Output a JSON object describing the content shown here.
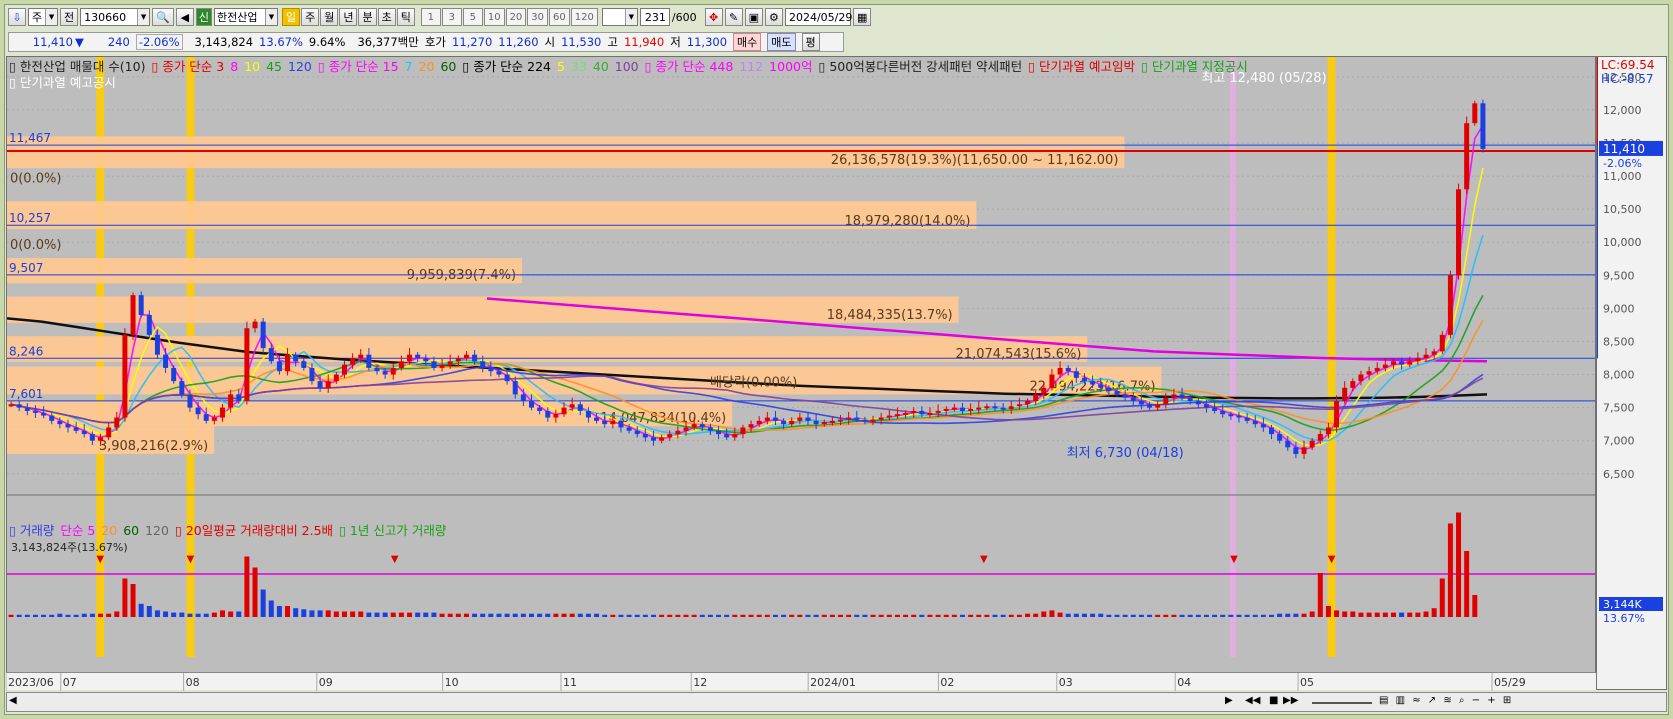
{
  "toolbar": {
    "market": "주",
    "mode": "전",
    "code": "130660",
    "name": "한전산업",
    "periods": [
      "일",
      "주",
      "월",
      "년",
      "분",
      "초",
      "틱"
    ],
    "active_period": "일",
    "minutes": [
      "1",
      "3",
      "5",
      "10",
      "20",
      "30",
      "60",
      "120"
    ],
    "count": "231",
    "count_total": "/600",
    "date": "2024/05/29"
  },
  "quote": {
    "price": "11,410",
    "arrow": "▼",
    "change": "240",
    "change_pct": "-2.06%",
    "volume": "3,143,824",
    "vol_ratio": "13.67%",
    "turnover": "9.64%",
    "amount": "36,377백만",
    "ask_label": "호가",
    "ask": "11,270",
    "bid": "11,260",
    "open_label": "시",
    "open": "11,530",
    "high_label": "고",
    "high": "11,940",
    "low_label": "저",
    "low": "11,300",
    "buy": "매수",
    "sell": "매도",
    "eval": "평"
  },
  "legend": {
    "line1": [
      {
        "t": "▯ 한전산업 매물대 수(10)",
        "c": "#222"
      },
      {
        "t": "▯ 종가 단순 3",
        "c": "#e00000"
      },
      {
        "t": "8",
        "c": "#ff00ff"
      },
      {
        "t": "10",
        "c": "#ffff00"
      },
      {
        "t": "45",
        "c": "#18a018"
      },
      {
        "t": "120",
        "c": "#3040e0"
      },
      {
        "t": "▯ 종가 단순 15",
        "c": "#ff00ff"
      },
      {
        "t": "7",
        "c": "#20c0ff"
      },
      {
        "t": "20",
        "c": "#ff9020"
      },
      {
        "t": "60",
        "c": "#006000"
      },
      {
        "t": "▯ 종가 단순 224",
        "c": "#000000"
      },
      {
        "t": "5",
        "c": "#ffff00"
      },
      {
        "t": "33",
        "c": "#70e070"
      },
      {
        "t": "40",
        "c": "#30b030"
      },
      {
        "t": "100",
        "c": "#8040a0"
      },
      {
        "t": "▯ 종가 단순 448",
        "c": "#ff00ff"
      },
      {
        "t": "112",
        "c": "#c080ff"
      },
      {
        "t": "1000억",
        "c": "#ff00ff"
      },
      {
        "t": "▯ 500억봉다른버전 강세패턴  약세패턴",
        "c": "#222"
      },
      {
        "t": "▯ 단기과열 예고임박",
        "c": "#e00000"
      },
      {
        "t": "▯ 단기과열 지정공시",
        "c": "#18a018"
      }
    ],
    "line2": "▯ 단기과열 예고공시",
    "vol_line": [
      {
        "t": "▯ 거래량",
        "c": "#3040e0"
      },
      {
        "t": "단순 5",
        "c": "#ff00ff"
      },
      {
        "t": "20",
        "c": "#ff9020"
      },
      {
        "t": "60",
        "c": "#006000"
      },
      {
        "t": "120",
        "c": "#666"
      },
      {
        "t": "▯ 20일평균 거래량대비 2.5배",
        "c": "#e00000"
      },
      {
        "t": "▯ 1년 신고가 거래량",
        "c": "#18a018"
      }
    ],
    "vol_value": "3,143,824주(13.67%)"
  },
  "colors": {
    "up": "#e00000",
    "down": "#1a40e0",
    "band": "#ffc891",
    "axis_red": "#e00000",
    "axis_blue": "#1a40e0"
  },
  "chart_data": {
    "type": "candlestick",
    "title": "한전산업",
    "x_labels": [
      "2023/06",
      "07",
      "08",
      "09",
      "10",
      "11",
      "12",
      "2024/01",
      "02",
      "03",
      "04",
      "05",
      "05/29"
    ],
    "ylim": [
      6300,
      12800
    ],
    "y_ticks": [
      6500,
      7000,
      7500,
      8000,
      8500,
      9000,
      9500,
      10000,
      10500,
      11000,
      11500,
      12000,
      12500
    ],
    "y_tick_labels": [
      "6,500",
      "7,000",
      "7,500",
      "8,000",
      "8,500",
      "9,000",
      "9,500",
      "10,000",
      "10,500",
      "11,000",
      "11,500",
      "12,000",
      "12,500"
    ],
    "last_price_label": "11,410",
    "last_change_label": "-2.06%",
    "lc_label": "LC:69.54",
    "hc_label": "HC:-8.57",
    "volume_profile": [
      {
        "label": "26,136,578(19.3%)(11,650.00 ~ 11,162.00)",
        "y0": 11120,
        "y1": 11600,
        "end": 0.755
      },
      {
        "label": "18,979,280(14.0%)",
        "y0": 10200,
        "y1": 10620,
        "end": 0.655
      },
      {
        "label": "9,959,839(7.4%)",
        "y0": 9380,
        "y1": 9760,
        "end": 0.348
      },
      {
        "label": "18,484,335(13.7%)",
        "y0": 8780,
        "y1": 9180,
        "end": 0.643
      },
      {
        "label": "21,074,543(15.6%)",
        "y0": 8190,
        "y1": 8580,
        "end": 0.73
      },
      {
        "label": "22,494,223(16.7%)",
        "y0": 7700,
        "y1": 8120,
        "end": 0.78
      },
      {
        "label": "14,047,834(10.4%)",
        "y0": 7220,
        "y1": 7600,
        "end": 0.49
      },
      {
        "label": "3,908,216(2.9%)",
        "y0": 6800,
        "y1": 7220,
        "end": 0.14
      }
    ],
    "hlines": [
      {
        "label": "11,467",
        "value": 11467,
        "color": "#1a40e0"
      },
      {
        "label": "10,257",
        "value": 10257,
        "color": "#1a40e0"
      },
      {
        "label": "9,507",
        "value": 9507,
        "color": "#1a40e0"
      },
      {
        "label": "8,246",
        "value": 8246,
        "color": "#1a40e0"
      },
      {
        "label": "7,601",
        "value": 7601,
        "color": "#1a40e0"
      }
    ],
    "annotations": [
      {
        "text": "0(0.0%)",
        "x": 0.002,
        "y": 10900
      },
      {
        "text": "0(0.0%)",
        "x": 0.002,
        "y": 9900
      },
      {
        "text": "배당락(0.00%)",
        "x": 0.475,
        "y": 7820
      },
      {
        "text": "최고 12,480 (05/28)",
        "x": 0.807,
        "y": 12420
      },
      {
        "text": "최저 6,730 (04/18)",
        "x": 0.716,
        "y": 6750
      }
    ],
    "highlights": [
      0.063,
      0.124,
      0.829,
      0.895
    ],
    "series_close": [
      7550,
      7500,
      7450,
      7420,
      7380,
      7300,
      7250,
      7200,
      7150,
      7100,
      7000,
      7050,
      7200,
      7350,
      8600,
      9200,
      8900,
      8600,
      8300,
      8100,
      7900,
      7700,
      7500,
      7400,
      7300,
      7350,
      7500,
      7700,
      7600,
      8700,
      8800,
      8400,
      8200,
      8050,
      8300,
      8200,
      8100,
      7900,
      7800,
      7900,
      8000,
      8150,
      8250,
      8300,
      8100,
      8050,
      8000,
      8100,
      8200,
      8300,
      8250,
      8200,
      8100,
      8150,
      8200,
      8250,
      8300,
      8200,
      8100,
      8050,
      8000,
      7900,
      7700,
      7600,
      7500,
      7450,
      7350,
      7400,
      7500,
      7550,
      7450,
      7350,
      7300,
      7250,
      7300,
      7200,
      7150,
      7100,
      7050,
      7000,
      7050,
      7100,
      7150,
      7200,
      7250,
      7200,
      7150,
      7100,
      7050,
      7100,
      7200,
      7250,
      7300,
      7350,
      7300,
      7250,
      7300,
      7350,
      7300,
      7250,
      7280,
      7300,
      7320,
      7350,
      7320,
      7300,
      7320,
      7350,
      7380,
      7400,
      7420,
      7450,
      7400,
      7420,
      7450,
      7480,
      7500,
      7450,
      7480,
      7500,
      7520,
      7500,
      7480,
      7520,
      7550,
      7600,
      7700,
      7800,
      8000,
      8100,
      8050,
      7950,
      7900,
      7850,
      7800,
      7750,
      7700,
      7650,
      7600,
      7550,
      7500,
      7550,
      7650,
      7700,
      7650,
      7600,
      7550,
      7500,
      7450,
      7400,
      7380,
      7350,
      7300,
      7250,
      7200,
      7100,
      7000,
      6900,
      6800,
      6900,
      7000,
      7100,
      7200,
      7600,
      7800,
      7900,
      8000,
      8050,
      8100,
      8150,
      8200,
      8150,
      8200,
      8250,
      8300,
      8350,
      8600,
      9500,
      10800,
      11800,
      12100,
      11410
    ],
    "volume": [
      0.02,
      0.02,
      0.02,
      0.02,
      0.02,
      0.02,
      0.03,
      0.02,
      0.02,
      0.03,
      0.03,
      0.03,
      0.03,
      0.05,
      0.35,
      0.3,
      0.12,
      0.1,
      0.06,
      0.05,
      0.04,
      0.04,
      0.03,
      0.03,
      0.03,
      0.04,
      0.06,
      0.05,
      0.05,
      0.55,
      0.45,
      0.25,
      0.15,
      0.1,
      0.1,
      0.08,
      0.07,
      0.06,
      0.06,
      0.06,
      0.05,
      0.05,
      0.05,
      0.05,
      0.04,
      0.04,
      0.04,
      0.04,
      0.04,
      0.04,
      0.04,
      0.04,
      0.04,
      0.03,
      0.03,
      0.03,
      0.03,
      0.03,
      0.03,
      0.03,
      0.03,
      0.03,
      0.03,
      0.03,
      0.03,
      0.03,
      0.03,
      0.03,
      0.03,
      0.03,
      0.03,
      0.03,
      0.03,
      0.02,
      0.02,
      0.02,
      0.02,
      0.02,
      0.02,
      0.02,
      0.02,
      0.02,
      0.02,
      0.02,
      0.02,
      0.02,
      0.02,
      0.02,
      0.02,
      0.02,
      0.02,
      0.02,
      0.02,
      0.02,
      0.02,
      0.02,
      0.02,
      0.02,
      0.02,
      0.02,
      0.02,
      0.02,
      0.02,
      0.02,
      0.02,
      0.02,
      0.02,
      0.02,
      0.02,
      0.02,
      0.02,
      0.02,
      0.02,
      0.02,
      0.02,
      0.02,
      0.02,
      0.02,
      0.02,
      0.02,
      0.02,
      0.02,
      0.02,
      0.02,
      0.02,
      0.03,
      0.03,
      0.05,
      0.06,
      0.04,
      0.03,
      0.03,
      0.03,
      0.03,
      0.03,
      0.02,
      0.02,
      0.02,
      0.02,
      0.02,
      0.02,
      0.02,
      0.02,
      0.02,
      0.02,
      0.02,
      0.02,
      0.02,
      0.02,
      0.02,
      0.02,
      0.02,
      0.02,
      0.02,
      0.02,
      0.02,
      0.03,
      0.03,
      0.03,
      0.03,
      0.05,
      0.4,
      0.1,
      0.06,
      0.05,
      0.05,
      0.04,
      0.04,
      0.04,
      0.04,
      0.04,
      0.04,
      0.04,
      0.04,
      0.05,
      0.08,
      0.35,
      0.85,
      0.95,
      0.6,
      0.2
    ],
    "ma224": [
      8850,
      8800,
      8720,
      8640,
      8560,
      8480,
      8410,
      8340,
      8300,
      8260,
      8220,
      8190,
      8160,
      8130,
      8100,
      8070,
      8040,
      8010,
      7980,
      7950,
      7920,
      7890,
      7860,
      7830,
      7810,
      7790,
      7770,
      7750,
      7730,
      7710,
      7700,
      7690,
      7680,
      7670,
      7660,
      7650,
      7645,
      7640,
      7640,
      7645,
      7650,
      7660,
      7680,
      7700
    ],
    "ma448": [
      9150,
      9050,
      8950,
      8850,
      8750,
      8650,
      8550,
      8450,
      8350,
      8300,
      8250,
      8220,
      8200
    ]
  },
  "xbar_labels": [
    "2023/06",
    "07",
    "08",
    "09",
    "10",
    "11",
    "12",
    "2024/01",
    "02",
    "03",
    "04",
    "05",
    "05/29"
  ],
  "axis_vol_labels": [
    "3,144K",
    "13.67%"
  ]
}
